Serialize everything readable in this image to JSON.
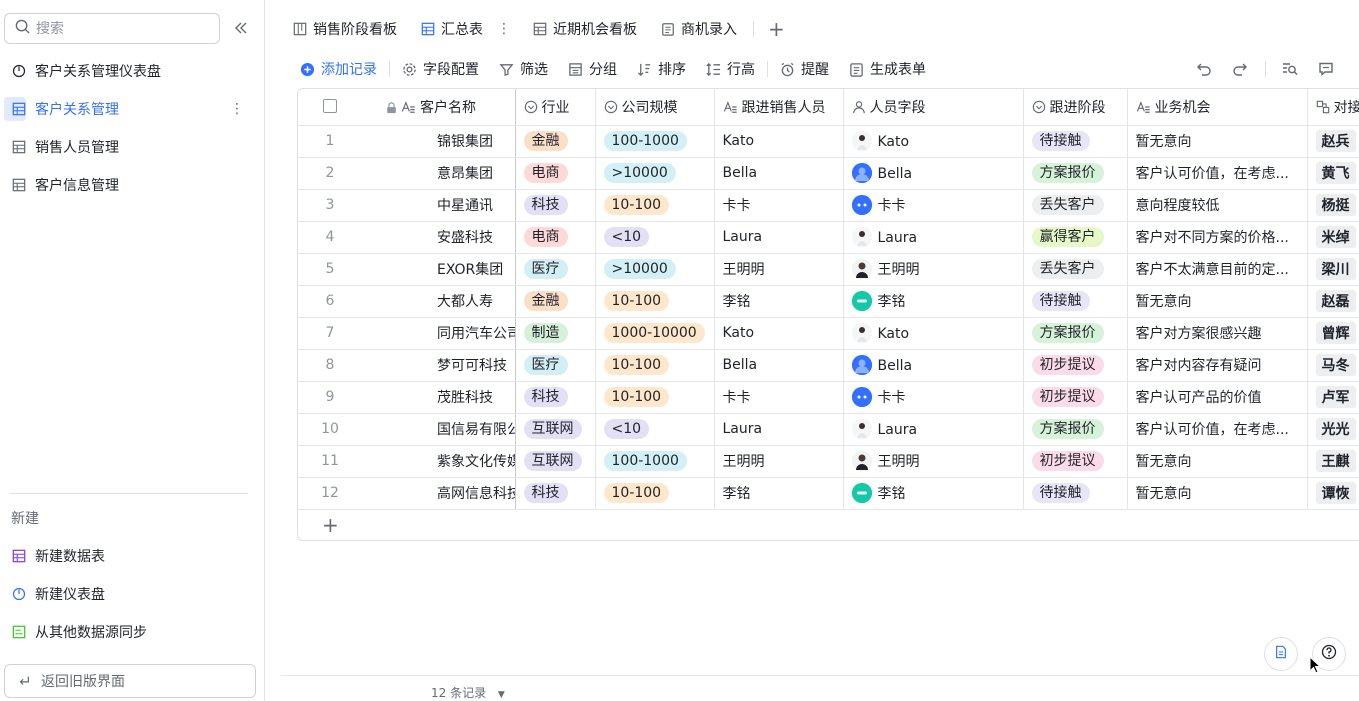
{
  "sidebar": {
    "search_placeholder": "搜索",
    "items": [
      {
        "label": "客户关系管理仪表盘",
        "icon": "dashboard-icon"
      },
      {
        "label": "客户关系管理",
        "icon": "table-icon"
      },
      {
        "label": "销售人员管理",
        "icon": "table-icon"
      },
      {
        "label": "客户信息管理",
        "icon": "table-icon"
      }
    ],
    "new_label": "新建",
    "new_items": [
      {
        "label": "新建数据表",
        "icon": "table-icon"
      },
      {
        "label": "新建仪表盘",
        "icon": "dashboard-icon"
      },
      {
        "label": "从其他数据源同步",
        "icon": "sync-icon"
      }
    ],
    "back_label": "返回旧版界面"
  },
  "tabs": [
    {
      "label": "销售阶段看板"
    },
    {
      "label": "汇总表"
    },
    {
      "label": "近期机会看板"
    },
    {
      "label": "商机录入"
    }
  ],
  "toolbar": {
    "add": "添加记录",
    "fields": "字段配置",
    "filter": "筛选",
    "group": "分组",
    "sort": "排序",
    "row_height": "行高",
    "remind": "提醒",
    "form": "生成表单"
  },
  "columns": {
    "name": "客户名称",
    "industry": "行业",
    "size": "公司规模",
    "sales": "跟进销售人员",
    "person": "人员字段",
    "stage": "跟进阶段",
    "opportunity": "业务机会",
    "contact": "对接"
  },
  "rows": [
    {
      "idx": "1",
      "name": "锦银集团",
      "industry": "金融",
      "size": "100-1000",
      "sales": "Kato",
      "person": "Kato",
      "stage": "待接触",
      "opportunity": "暂无意向",
      "contact": "赵兵"
    },
    {
      "idx": "2",
      "name": "意昂集团",
      "industry": "电商",
      "size": ">10000",
      "sales": "Bella",
      "person": "Bella",
      "stage": "方案报价",
      "opportunity": "客户认可价值，在考虑...",
      "contact": "黄飞"
    },
    {
      "idx": "3",
      "name": "中星通讯",
      "industry": "科技",
      "size": "10-100",
      "sales": "卡卡",
      "person": "卡卡",
      "stage": "丢失客户",
      "opportunity": "意向程度较低",
      "contact": "杨挺"
    },
    {
      "idx": "4",
      "name": "安盛科技",
      "industry": "电商",
      "size": "<10",
      "sales": "Laura",
      "person": "Laura",
      "stage": "赢得客户",
      "opportunity": "客户对不同方案的价格...",
      "contact": "米绰"
    },
    {
      "idx": "5",
      "name": "EXOR集团",
      "industry": "医疗",
      "size": ">10000",
      "sales": "王明明",
      "person": "王明明",
      "stage": "丢失客户",
      "opportunity": "客户不太满意目前的定...",
      "contact": "梁川"
    },
    {
      "idx": "6",
      "name": "大都人寿",
      "industry": "金融",
      "size": "10-100",
      "sales": "李铭",
      "person": "李铭",
      "stage": "待接触",
      "opportunity": "暂无意向",
      "contact": "赵磊"
    },
    {
      "idx": "7",
      "name": "同用汽车公司",
      "industry": "制造",
      "size": "1000-10000",
      "sales": "Kato",
      "person": "Kato",
      "stage": "方案报价",
      "opportunity": "客户对方案很感兴趣",
      "contact": "曾辉"
    },
    {
      "idx": "8",
      "name": "梦可可科技",
      "industry": "医疗",
      "size": "10-100",
      "sales": "Bella",
      "person": "Bella",
      "stage": "初步提议",
      "opportunity": "客户对内容存有疑问",
      "contact": "马冬"
    },
    {
      "idx": "9",
      "name": "茂胜科技",
      "industry": "科技",
      "size": "10-100",
      "sales": "卡卡",
      "person": "卡卡",
      "stage": "初步提议",
      "opportunity": "客户认可产品的价值",
      "contact": "卢军"
    },
    {
      "idx": "10",
      "name": "国信易有限公司",
      "industry": "互联网",
      "size": "<10",
      "sales": "Laura",
      "person": "Laura",
      "stage": "方案报价",
      "opportunity": "客户认可价值，在考虑...",
      "contact": "光光"
    },
    {
      "idx": "11",
      "name": "紫象文化传媒",
      "industry": "互联网",
      "size": "100-1000",
      "sales": "王明明",
      "person": "王明明",
      "stage": "初步提议",
      "opportunity": "暂无意向",
      "contact": "王麒"
    },
    {
      "idx": "12",
      "name": "高网信息科技",
      "industry": "科技",
      "size": "10-100",
      "sales": "李铭",
      "person": "李铭",
      "stage": "待接触",
      "opportunity": "暂无意向",
      "contact": "谭恢"
    }
  ],
  "footer": {
    "count": "12 条记录"
  },
  "avatar_initials": {
    "李铭": "李铭",
    "卡卡": "卡卡"
  }
}
